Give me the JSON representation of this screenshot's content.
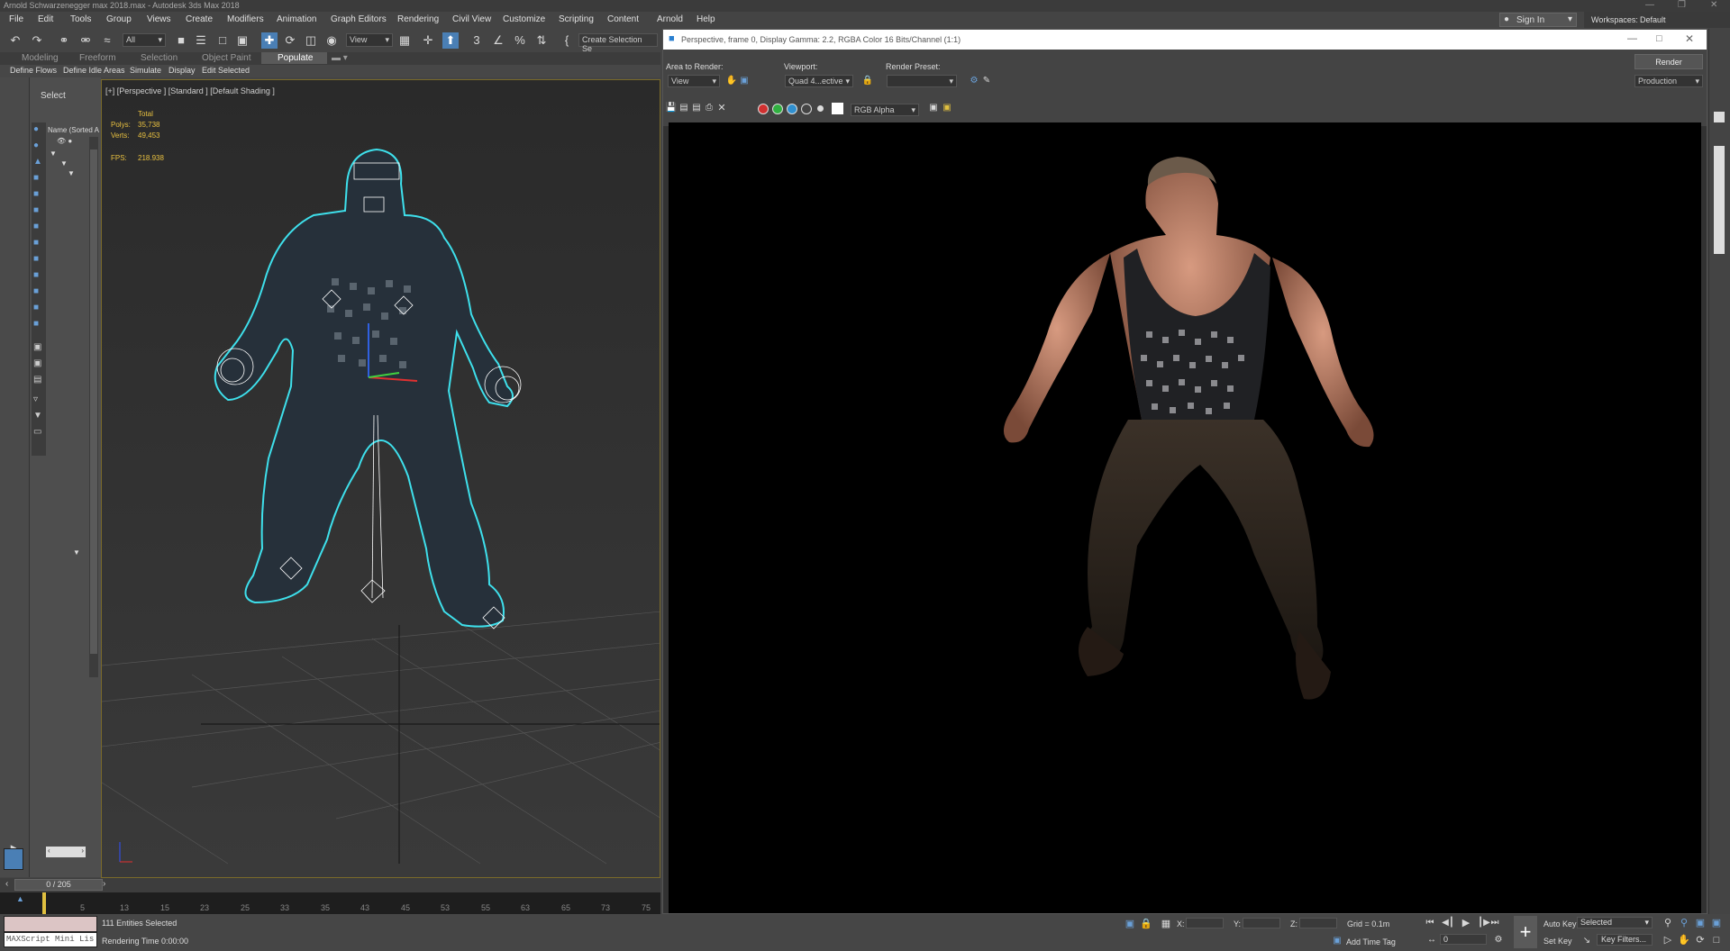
{
  "window": {
    "title": "Arnold Schwarzenegger max 2018.max - Autodesk 3ds Max 2018",
    "signin": "Sign In",
    "workspaces_label": "Workspaces:",
    "workspaces_value": "Default"
  },
  "menu": [
    "File",
    "Edit",
    "Tools",
    "Group",
    "Views",
    "Create",
    "Modifiers",
    "Animation",
    "Graph Editors",
    "Rendering",
    "Civil View",
    "Customize",
    "Scripting",
    "Content",
    "Arnold",
    "Help"
  ],
  "toolbar": {
    "selection_filter": "All",
    "ref_coord": "View",
    "named_selection": "Create Selection Se"
  },
  "ribbon": {
    "tabs": [
      "Modeling",
      "Freeform",
      "Selection",
      "Object Paint",
      "Populate"
    ],
    "active_tab": "Populate",
    "commands": [
      "Define Flows",
      "Define Idle Areas",
      "Simulate",
      "Display",
      "Edit Selected"
    ]
  },
  "explorer": {
    "select_label": "Select",
    "name_header": "Name (Sorted A"
  },
  "viewport": {
    "label": "[+] [Perspective ] [Standard ] [Default Shading ]",
    "stats": {
      "total_label": "Total",
      "polys_label": "Polys:",
      "polys_value": "35,738",
      "verts_label": "Verts:",
      "verts_value": "49,453",
      "fps_label": "FPS:",
      "fps_value": "218.938"
    }
  },
  "timeline": {
    "frame": "0 / 205",
    "ticks": [
      "5",
      "13",
      "15",
      "23",
      "25",
      "33",
      "35",
      "43",
      "45",
      "53",
      "55",
      "63",
      "65",
      "73",
      "75"
    ]
  },
  "status": {
    "maxscript": "MAXScript Mini Lis",
    "selected_count": "111 Entities Selected",
    "render_time": "Rendering Time  0:00:00",
    "x_label": "X:",
    "y_label": "Y:",
    "z_label": "Z:",
    "grid": "Grid = 0.1m",
    "add_time_tag": "Add Time Tag",
    "auto_key": "Auto Key",
    "set_key": "Set Key",
    "key_mode": "Selected",
    "key_filters": "Key Filters...",
    "frame_field": "0"
  },
  "render_window": {
    "title": "Perspective, frame 0, Display Gamma: 2.2, RGBA Color 16 Bits/Channel (1:1)",
    "area_to_render_label": "Area to Render:",
    "area_to_render_value": "View",
    "viewport_label": "Viewport:",
    "viewport_value": "Quad 4...ective",
    "render_preset_label": "Render Preset:",
    "render_preset_value": "",
    "render_button": "Render",
    "production": "Production",
    "channel": "RGB Alpha"
  }
}
